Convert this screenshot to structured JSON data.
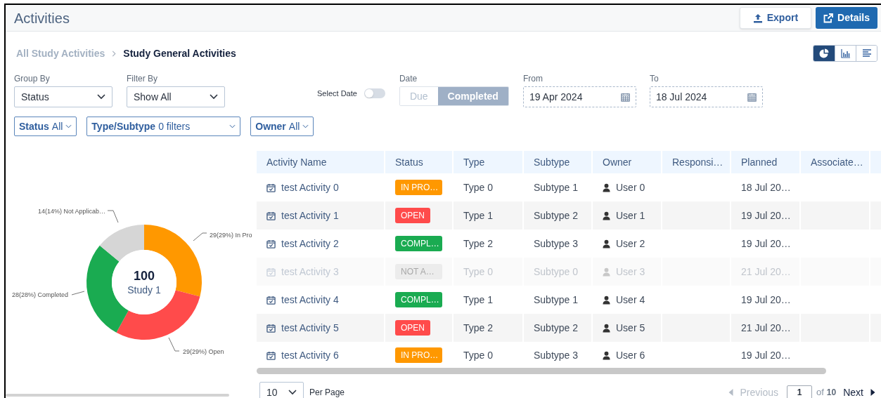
{
  "header": {
    "title": "Activities",
    "buttons": [
      {
        "kind": "export",
        "label": "Export"
      },
      {
        "kind": "details",
        "label": "Details"
      }
    ]
  },
  "breadcrumb": [
    {
      "label": "All Study Activities",
      "current": false
    },
    {
      "label": "Study General Activities",
      "current": true
    }
  ],
  "view_buttons": [
    {
      "kind": "pie",
      "selected": true
    },
    {
      "kind": "bar",
      "selected": false
    },
    {
      "kind": "list",
      "selected": false
    }
  ],
  "filters": {
    "group_by": {
      "label": "Group By",
      "value": "Status"
    },
    "filter_by": {
      "label": "Filter By",
      "value": "Show All"
    },
    "select_date": {
      "label": "Select Date",
      "on": false
    },
    "date": {
      "label": "Date",
      "options": [
        {
          "label": "Due",
          "selected": false
        },
        {
          "label": "Completed",
          "selected": true
        }
      ]
    },
    "from": {
      "label": "From",
      "value": "19 Apr 2024"
    },
    "to": {
      "label": "To",
      "value": "18 Jul 2024"
    }
  },
  "pills": [
    {
      "name": "Status",
      "value": "All"
    },
    {
      "name": "Type/Subtype",
      "value": "0 filters"
    },
    {
      "name": "Owner",
      "value": "All"
    }
  ],
  "chart_panel": {
    "center_value": "100",
    "center_label": "Study 1",
    "chart_data": {
      "type": "donut",
      "categories": [
        "29(29%) In Pro",
        "29(29%) Open",
        "28(28%) Completed",
        "14(14%) Not Applicab…"
      ],
      "values": [
        29,
        29,
        28,
        14
      ],
      "colors": [
        "#ff9800",
        "#ff4b4b",
        "#1aab51",
        "#d6d6d6"
      ]
    }
  },
  "table": {
    "columns": [
      "Activity Name",
      "Status",
      "Type",
      "Subtype",
      "Owner",
      "Responsi…",
      "Planned",
      "Associate…"
    ],
    "rows": [
      {
        "name": "test Activity 0",
        "status": "IN PRO…",
        "kind": "in_progress",
        "type": "Type 0",
        "subtype": "Subtype 1",
        "owner": "User 0",
        "planned": "18 Jul 20…",
        "disabled": false
      },
      {
        "name": "test Activity 1",
        "status": "OPEN",
        "kind": "open",
        "type": "Type 1",
        "subtype": "Subtype 2",
        "owner": "User 1",
        "planned": "19 Jul 20…",
        "disabled": false
      },
      {
        "name": "test Activity 2",
        "status": "COMPL…",
        "kind": "completed",
        "type": "Type 2",
        "subtype": "Subtype 3",
        "owner": "User 2",
        "planned": "19 Jul 20…",
        "disabled": false
      },
      {
        "name": "test Activity 3",
        "status": "NOT A…",
        "kind": "not_applicable",
        "type": "Type 0",
        "subtype": "Subtype 0",
        "owner": "User 3",
        "planned": "21 Jul 20…",
        "disabled": true
      },
      {
        "name": "test Activity 4",
        "status": "COMPL…",
        "kind": "completed",
        "type": "Type 1",
        "subtype": "Subtype 1",
        "owner": "User 4",
        "planned": "19 Jul 20…",
        "disabled": false
      },
      {
        "name": "test Activity 5",
        "status": "OPEN",
        "kind": "open",
        "type": "Type 2",
        "subtype": "Subtype 2",
        "owner": "User 5",
        "planned": "21 Jul 20…",
        "disabled": false
      },
      {
        "name": "test Activity 6",
        "status": "IN PRO…",
        "kind": "in_progress",
        "type": "Type 0",
        "subtype": "Subtype 3",
        "owner": "User 6",
        "planned": "19 Jul 20…",
        "disabled": false
      }
    ]
  },
  "pagination": {
    "per_page": "10",
    "per_page_label": "Per Page",
    "previous": "Previous",
    "page": "1",
    "of": "of",
    "total": "10",
    "next": "Next",
    "previous_disabled": true
  }
}
